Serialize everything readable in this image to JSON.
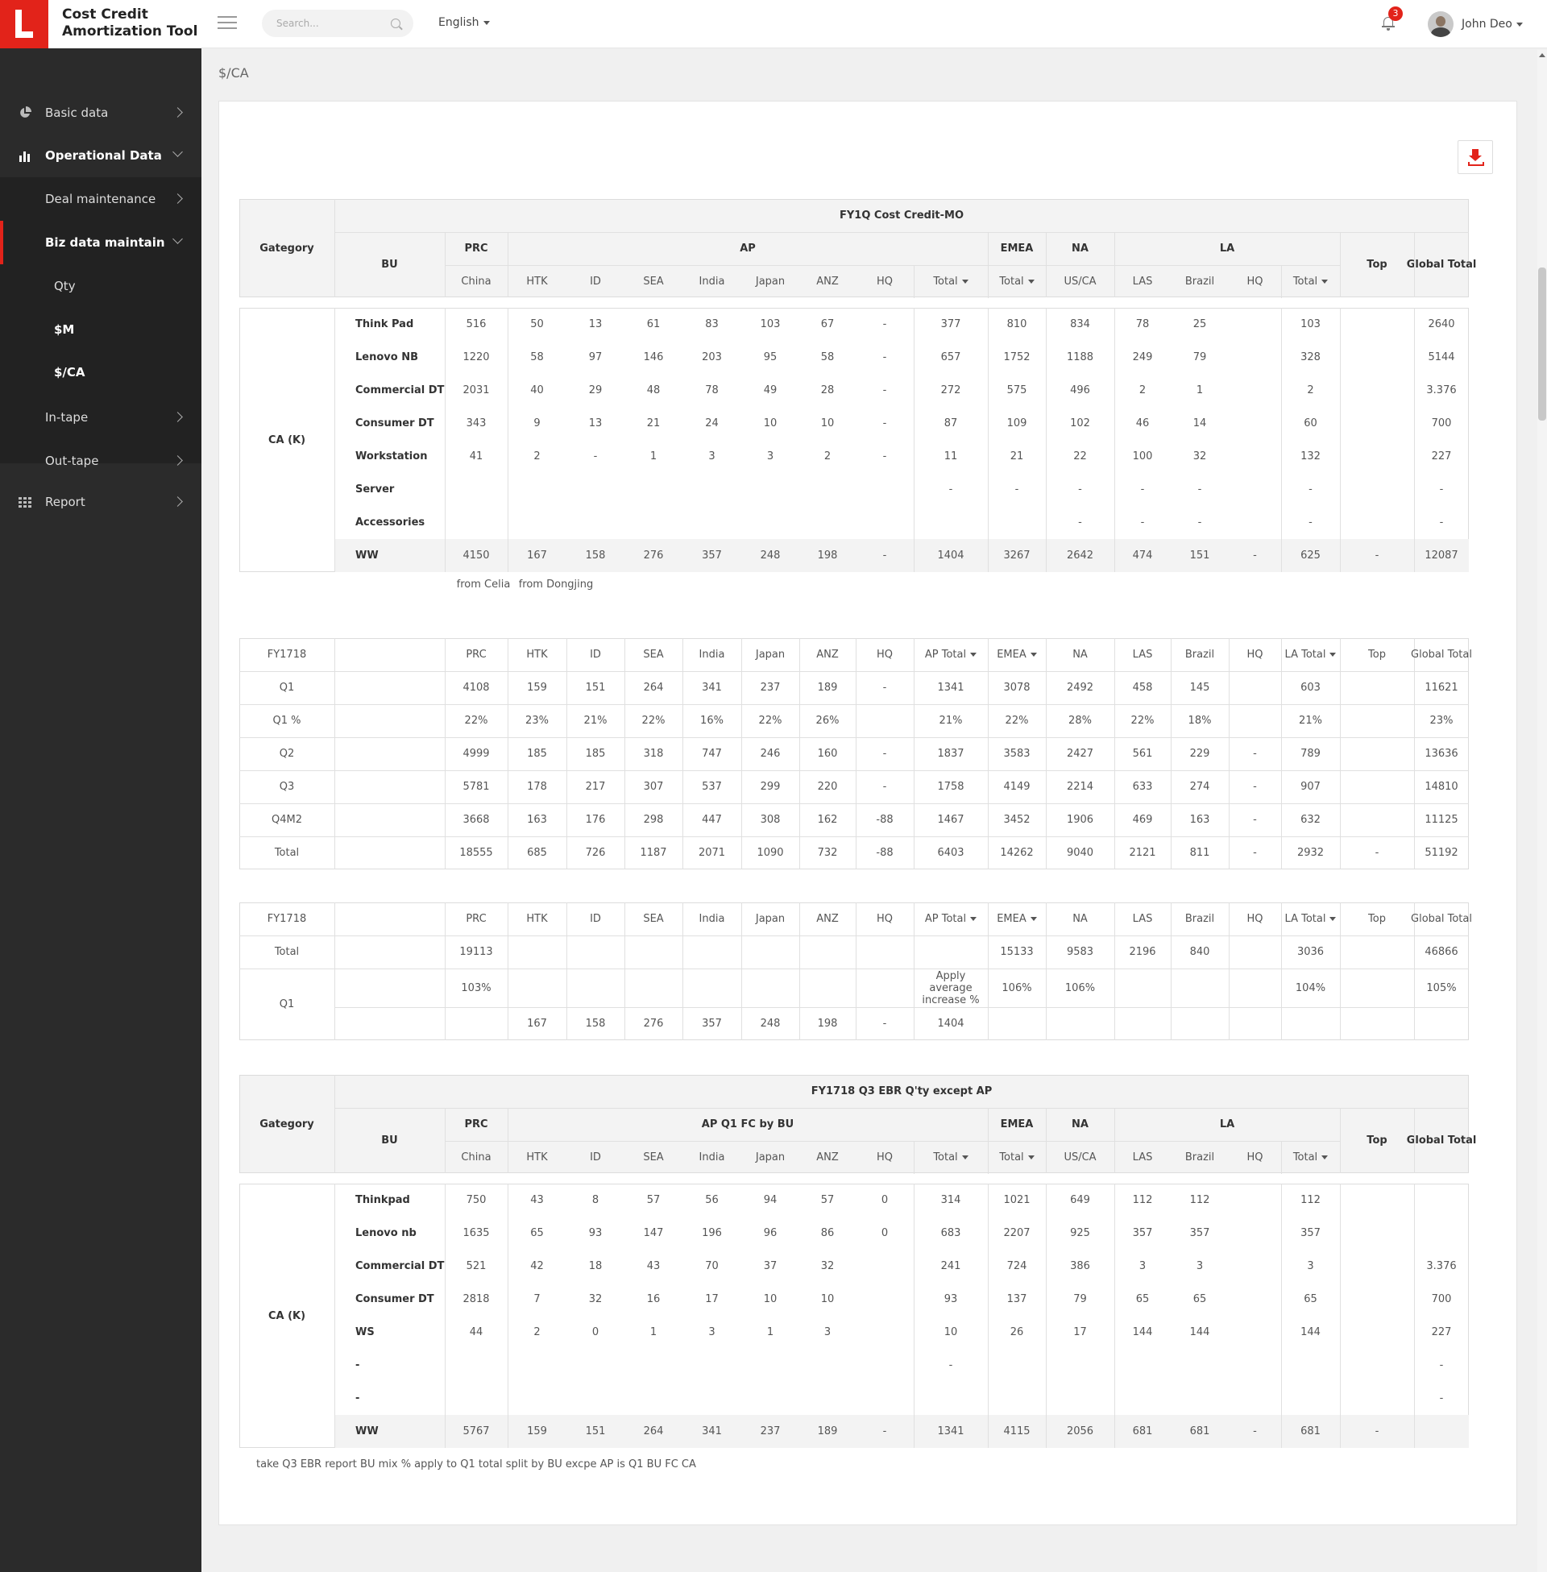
{
  "app": {
    "title_line1": "Cost Credit",
    "title_line2": "Amortization Tool"
  },
  "header": {
    "search_placeholder": "Search...",
    "language": "English",
    "notification_count": "3",
    "user_name": "John Deo"
  },
  "sidebar": {
    "basic_data": "Basic data",
    "operational_data": "Operational Data",
    "deal_maintenance": "Deal maintenance",
    "biz_data_maintain": "Biz data maintain",
    "qty": "Qty",
    "m": "$M",
    "ca": "$/CA",
    "in_tape": "In-tape",
    "out_tape": "Out-tape",
    "report": "Report"
  },
  "breadcrumb": "$/CA",
  "colors": {
    "accent": "#e2231a",
    "sidebar": "#2b2b2b",
    "header_gray": "#f3f3f3"
  },
  "table1": {
    "title": "FY1Q Cost Credit-MO",
    "category": "Gategory",
    "bu": "BU",
    "groups": [
      "PRC",
      "AP",
      "EMEA",
      "NA",
      "LA",
      "Top",
      "Global Total"
    ],
    "subcols": [
      "China",
      "HTK",
      "ID",
      "SEA",
      "India",
      "Japan",
      "ANZ",
      "HQ",
      "Total",
      "Total",
      "US/CA",
      "LAS",
      "Brazil",
      "HQ",
      "Total"
    ],
    "row_label": "CA (K)",
    "rows": [
      {
        "name": "Think Pad",
        "v": [
          "516",
          "50",
          "13",
          "61",
          "83",
          "103",
          "67",
          "-",
          "377",
          "810",
          "834",
          "78",
          "25",
          "",
          "103",
          "",
          "2640"
        ]
      },
      {
        "name": "Lenovo NB",
        "v": [
          "1220",
          "58",
          "97",
          "146",
          "203",
          "95",
          "58",
          "-",
          "657",
          "1752",
          "1188",
          "249",
          "79",
          "",
          "328",
          "",
          "5144"
        ]
      },
      {
        "name": "Commercial DT",
        "v": [
          "2031",
          "40",
          "29",
          "48",
          "78",
          "49",
          "28",
          "-",
          "272",
          "575",
          "496",
          "2",
          "1",
          "",
          "2",
          "",
          "3.376"
        ]
      },
      {
        "name": "Consumer DT",
        "v": [
          "343",
          "9",
          "13",
          "21",
          "24",
          "10",
          "10",
          "-",
          "87",
          "109",
          "102",
          "46",
          "14",
          "",
          "60",
          "",
          "700"
        ]
      },
      {
        "name": "Workstation",
        "v": [
          "41",
          "2",
          "-",
          "1",
          "3",
          "3",
          "2",
          "-",
          "11",
          "21",
          "22",
          "100",
          "32",
          "",
          "132",
          "",
          "227"
        ]
      },
      {
        "name": "Server",
        "v": [
          "",
          "",
          "",
          "",
          "",
          "",
          "",
          "",
          "-",
          "-",
          "-",
          "-",
          "-",
          "",
          "-",
          "",
          "-"
        ]
      },
      {
        "name": "Accessories",
        "v": [
          "",
          "",
          "",
          "",
          "",
          "",
          "",
          "",
          "",
          "",
          "-",
          "-",
          "-",
          "",
          "-",
          "",
          "-"
        ]
      }
    ],
    "ww": {
      "name": "WW",
      "v": [
        "4150",
        "167",
        "158",
        "276",
        "357",
        "248",
        "198",
        "-",
        "1404",
        "3267",
        "2642",
        "474",
        "151",
        "-",
        "625",
        "-",
        "12087"
      ]
    },
    "note1": "from Celia",
    "note2": "from Dongjing"
  },
  "table2": {
    "headers": [
      "FY1718",
      "",
      "PRC",
      "HTK",
      "ID",
      "SEA",
      "India",
      "Japan",
      "ANZ",
      "HQ",
      "AP Total",
      "EMEA",
      "NA",
      "LAS",
      "Brazil",
      "HQ",
      "LA Total",
      "Top",
      "Global Total"
    ],
    "rows": [
      [
        "Q1",
        "",
        "4108",
        "159",
        "151",
        "264",
        "341",
        "237",
        "189",
        "-",
        "1341",
        "3078",
        "2492",
        "458",
        "145",
        "",
        "603",
        "",
        "11621"
      ],
      [
        "Q1 %",
        "",
        "22%",
        "23%",
        "21%",
        "22%",
        "16%",
        "22%",
        "26%",
        "",
        "21%",
        "22%",
        "28%",
        "22%",
        "18%",
        "",
        "21%",
        "",
        "23%"
      ],
      [
        "Q2",
        "",
        "4999",
        "185",
        "185",
        "318",
        "747",
        "246",
        "160",
        "-",
        "1837",
        "3583",
        "2427",
        "561",
        "229",
        "-",
        "789",
        "",
        "13636"
      ],
      [
        "Q3",
        "",
        "5781",
        "178",
        "217",
        "307",
        "537",
        "299",
        "220",
        "-",
        "1758",
        "4149",
        "2214",
        "633",
        "274",
        "-",
        "907",
        "",
        "14810"
      ],
      [
        "Q4M2",
        "",
        "3668",
        "163",
        "176",
        "298",
        "447",
        "308",
        "162",
        "-88",
        "1467",
        "3452",
        "1906",
        "469",
        "163",
        "-",
        "632",
        "",
        "11125"
      ],
      [
        "Total",
        "",
        "18555",
        "685",
        "726",
        "1187",
        "2071",
        "1090",
        "732",
        "-88",
        "6403",
        "14262",
        "9040",
        "2121",
        "811",
        "-",
        "2932",
        "-",
        "51192"
      ]
    ]
  },
  "table3": {
    "headers": [
      "FY1718",
      "",
      "PRC",
      "HTK",
      "ID",
      "SEA",
      "India",
      "Japan",
      "ANZ",
      "HQ",
      "AP Total",
      "EMEA",
      "NA",
      "LAS",
      "Brazil",
      "HQ",
      "LA Total",
      "Top",
      "Global Total"
    ],
    "total_row": [
      "Total",
      "",
      "19113",
      "",
      "",
      "",
      "",
      "",
      "",
      "",
      "",
      "15133",
      "9583",
      "2196",
      "840",
      "",
      "3036",
      "",
      "46866"
    ],
    "q1_label": "Q1",
    "q1_row_a": [
      "",
      "103%",
      "",
      "",
      "",
      "",
      "",
      "",
      "",
      "Apply average increase %",
      "106%",
      "106%",
      "",
      "",
      "",
      "104%",
      "",
      "105%"
    ],
    "q1_row_b": [
      "",
      "",
      "167",
      "158",
      "276",
      "357",
      "248",
      "198",
      "-",
      "1404",
      "",
      "",
      "",
      "",
      "",
      "",
      "",
      ""
    ]
  },
  "table4": {
    "title": "FY1718 Q3 EBR Q'ty except AP",
    "category": "Gategory",
    "bu": "BU",
    "groups": [
      "PRC",
      "AP Q1 FC by BU",
      "EMEA",
      "NA",
      "LA",
      "Top",
      "Global Total"
    ],
    "subcols": [
      "China",
      "HTK",
      "ID",
      "SEA",
      "India",
      "Japan",
      "ANZ",
      "HQ",
      "Total",
      "Total",
      "US/CA",
      "LAS",
      "Brazil",
      "HQ",
      "Total"
    ],
    "row_label": "CA (K)",
    "rows": [
      {
        "name": "Thinkpad",
        "v": [
          "750",
          "43",
          "8",
          "57",
          "56",
          "94",
          "57",
          "0",
          "314",
          "1021",
          "649",
          "112",
          "112",
          "",
          "112",
          "",
          ""
        ]
      },
      {
        "name": "Lenovo nb",
        "v": [
          "1635",
          "65",
          "93",
          "147",
          "196",
          "96",
          "86",
          "0",
          "683",
          "2207",
          "925",
          "357",
          "357",
          "",
          "357",
          "",
          ""
        ]
      },
      {
        "name": "Commercial DT",
        "v": [
          "521",
          "42",
          "18",
          "43",
          "70",
          "37",
          "32",
          "",
          "241",
          "724",
          "386",
          "3",
          "3",
          "",
          "3",
          "",
          "3.376"
        ]
      },
      {
        "name": "Consumer DT",
        "v": [
          "2818",
          "7",
          "32",
          "16",
          "17",
          "10",
          "10",
          "",
          "93",
          "137",
          "79",
          "65",
          "65",
          "",
          "65",
          "",
          "700"
        ]
      },
      {
        "name": "WS",
        "v": [
          "44",
          "2",
          "0",
          "1",
          "3",
          "1",
          "3",
          "",
          "10",
          "26",
          "17",
          "144",
          "144",
          "",
          "144",
          "",
          "227"
        ]
      },
      {
        "name": "-",
        "v": [
          "",
          "",
          "",
          "",
          "",
          "",
          "",
          "",
          "-",
          "",
          "",
          "",
          "",
          "",
          "",
          "",
          "-"
        ]
      },
      {
        "name": "-",
        "v": [
          "",
          "",
          "",
          "",
          "",
          "",
          "",
          "",
          "",
          "",
          "",
          "",
          "",
          "",
          "",
          "",
          "-"
        ]
      }
    ],
    "ww": {
      "name": "WW",
      "v": [
        "5767",
        "159",
        "151",
        "264",
        "341",
        "237",
        "189",
        "-",
        "1341",
        "4115",
        "2056",
        "681",
        "681",
        "-",
        "681",
        "-",
        ""
      ]
    },
    "footnote": "take Q3 EBR report BU mix % apply to Q1 total split by BU excpe AP is Q1 BU FC CA"
  }
}
